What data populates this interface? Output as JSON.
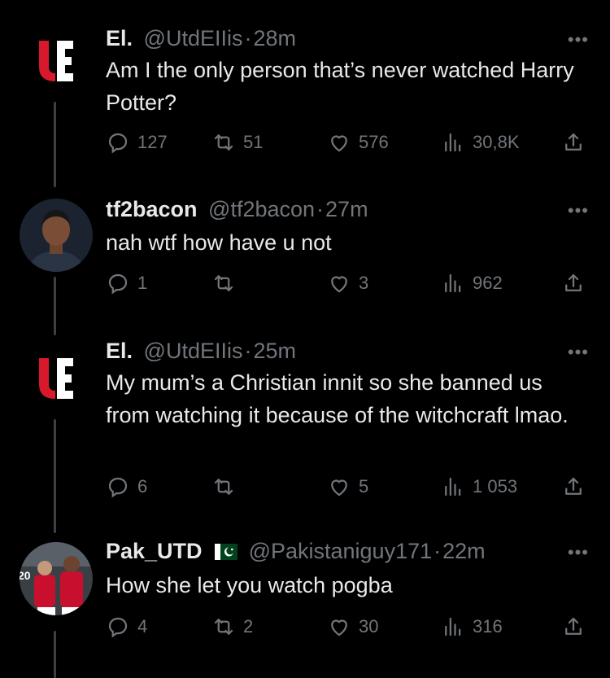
{
  "tweets": [
    {
      "name": "El.",
      "handle": "@UtdEIIis",
      "time": "28m",
      "text": "Am I the only person that’s never watched Harry Potter?",
      "replies": "127",
      "retweets": "51",
      "likes": "576",
      "views": "30,8K",
      "avatar_icon": "club-logo-icon"
    },
    {
      "name": "tf2bacon",
      "handle": "@tf2bacon",
      "time": "27m",
      "text": "nah wtf how have u not",
      "replies": "1",
      "retweets": "",
      "likes": "3",
      "views": "962",
      "avatar_icon": "profile-photo"
    },
    {
      "name": "El.",
      "handle": "@UtdEIIis",
      "time": "25m",
      "text": "My mum’s a Christian innit so she banned us from watching it because of the witchcraft lmao.",
      "replies": "6",
      "retweets": "",
      "likes": "5",
      "views": "1 053",
      "avatar_icon": "club-logo-icon"
    },
    {
      "name": "Pak_UTD",
      "handle": "@Pakistaniguy171",
      "time": "22m",
      "text": "How she let you watch pogba",
      "replies": "4",
      "retweets": "2",
      "likes": "30",
      "views": "316",
      "avatar_icon": "profile-photo",
      "avatar_number": "20"
    }
  ],
  "separator": "·",
  "more_label": "•••",
  "colors": {
    "background": "#000000",
    "text": "#e7e9ea",
    "muted": "#71767b",
    "logo_red": "#d7192b"
  }
}
